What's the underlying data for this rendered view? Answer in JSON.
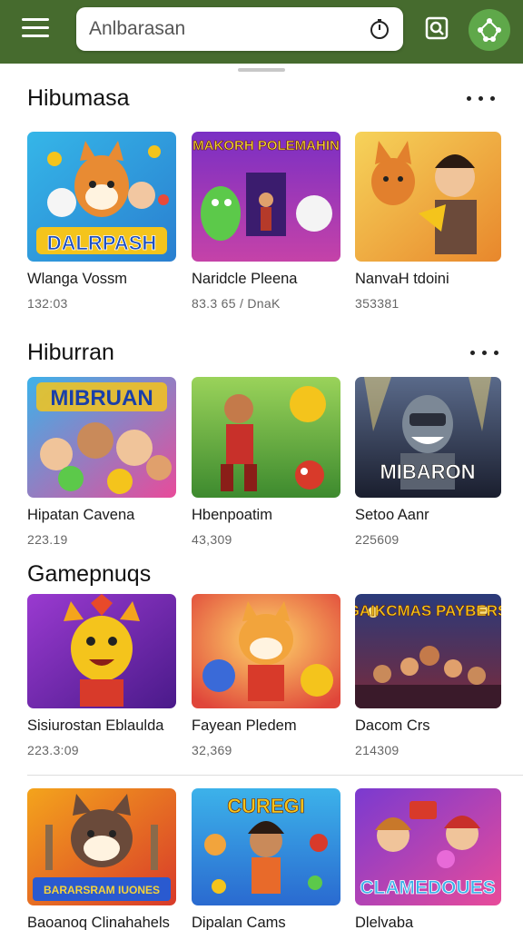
{
  "search": {
    "placeholder": "Anlbarasan"
  },
  "icons": {
    "menu": "hamburger-icon",
    "timer": "stopwatch-icon",
    "scan": "scan-search-icon",
    "profile": "share-nodes-icon"
  },
  "colors": {
    "appbar": "#466b2e",
    "avatar": "#5fa84a"
  },
  "sections": [
    {
      "title": "Hibumasa",
      "items": [
        {
          "title": "Wlanga Vossm",
          "sub": "132:03",
          "banner": "DALRPASH"
        },
        {
          "title": "Naridcle Pleena",
          "sub": "83.3 65 / DnaK",
          "banner": "MAKORH POLEMAHIN"
        },
        {
          "title": "NanvaH tdoini",
          "sub": "353381",
          "banner": ""
        }
      ]
    },
    {
      "title": "Hiburran",
      "items": [
        {
          "title": "Hipatan Cavena",
          "sub": "223.19",
          "banner": "MIBRUAN"
        },
        {
          "title": "Hbenpoatim",
          "sub": "43,309",
          "banner": ""
        },
        {
          "title": "Setoo Aanr",
          "sub": "225609",
          "banner": "MIBARON"
        }
      ]
    },
    {
      "title": "Gamepnuqs",
      "items": [
        {
          "title": "Sisiurostan Eblaulda",
          "sub": "223.3:09",
          "banner": ""
        },
        {
          "title": "Fayean Pledem",
          "sub": "32,369",
          "banner": ""
        },
        {
          "title": "Dacom Crs",
          "sub": "214309",
          "banner": "GAIKCMAS PAYBERS"
        }
      ]
    },
    {
      "title": "",
      "items": [
        {
          "title": "Baoanoq Clinahahels",
          "sub": "",
          "banner": "BARARSRAM IUONES"
        },
        {
          "title": "Dipalan Cams",
          "sub": "",
          "banner": "CUREGI"
        },
        {
          "title": "Dlelvaba",
          "sub": "",
          "banner": "CLAMEDOUES"
        }
      ]
    }
  ]
}
